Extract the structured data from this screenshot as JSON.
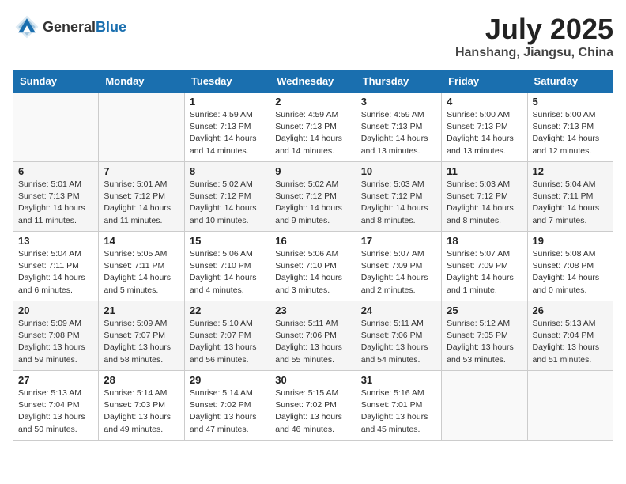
{
  "header": {
    "logo_general": "General",
    "logo_blue": "Blue",
    "title": "July 2025",
    "location": "Hanshang, Jiangsu, China"
  },
  "weekdays": [
    "Sunday",
    "Monday",
    "Tuesday",
    "Wednesday",
    "Thursday",
    "Friday",
    "Saturday"
  ],
  "weeks": [
    [
      {
        "day": "",
        "info": ""
      },
      {
        "day": "",
        "info": ""
      },
      {
        "day": "1",
        "info": "Sunrise: 4:59 AM\nSunset: 7:13 PM\nDaylight: 14 hours and 14 minutes."
      },
      {
        "day": "2",
        "info": "Sunrise: 4:59 AM\nSunset: 7:13 PM\nDaylight: 14 hours and 14 minutes."
      },
      {
        "day": "3",
        "info": "Sunrise: 4:59 AM\nSunset: 7:13 PM\nDaylight: 14 hours and 13 minutes."
      },
      {
        "day": "4",
        "info": "Sunrise: 5:00 AM\nSunset: 7:13 PM\nDaylight: 14 hours and 13 minutes."
      },
      {
        "day": "5",
        "info": "Sunrise: 5:00 AM\nSunset: 7:13 PM\nDaylight: 14 hours and 12 minutes."
      }
    ],
    [
      {
        "day": "6",
        "info": "Sunrise: 5:01 AM\nSunset: 7:13 PM\nDaylight: 14 hours and 11 minutes."
      },
      {
        "day": "7",
        "info": "Sunrise: 5:01 AM\nSunset: 7:12 PM\nDaylight: 14 hours and 11 minutes."
      },
      {
        "day": "8",
        "info": "Sunrise: 5:02 AM\nSunset: 7:12 PM\nDaylight: 14 hours and 10 minutes."
      },
      {
        "day": "9",
        "info": "Sunrise: 5:02 AM\nSunset: 7:12 PM\nDaylight: 14 hours and 9 minutes."
      },
      {
        "day": "10",
        "info": "Sunrise: 5:03 AM\nSunset: 7:12 PM\nDaylight: 14 hours and 8 minutes."
      },
      {
        "day": "11",
        "info": "Sunrise: 5:03 AM\nSunset: 7:12 PM\nDaylight: 14 hours and 8 minutes."
      },
      {
        "day": "12",
        "info": "Sunrise: 5:04 AM\nSunset: 7:11 PM\nDaylight: 14 hours and 7 minutes."
      }
    ],
    [
      {
        "day": "13",
        "info": "Sunrise: 5:04 AM\nSunset: 7:11 PM\nDaylight: 14 hours and 6 minutes."
      },
      {
        "day": "14",
        "info": "Sunrise: 5:05 AM\nSunset: 7:11 PM\nDaylight: 14 hours and 5 minutes."
      },
      {
        "day": "15",
        "info": "Sunrise: 5:06 AM\nSunset: 7:10 PM\nDaylight: 14 hours and 4 minutes."
      },
      {
        "day": "16",
        "info": "Sunrise: 5:06 AM\nSunset: 7:10 PM\nDaylight: 14 hours and 3 minutes."
      },
      {
        "day": "17",
        "info": "Sunrise: 5:07 AM\nSunset: 7:09 PM\nDaylight: 14 hours and 2 minutes."
      },
      {
        "day": "18",
        "info": "Sunrise: 5:07 AM\nSunset: 7:09 PM\nDaylight: 14 hours and 1 minute."
      },
      {
        "day": "19",
        "info": "Sunrise: 5:08 AM\nSunset: 7:08 PM\nDaylight: 14 hours and 0 minutes."
      }
    ],
    [
      {
        "day": "20",
        "info": "Sunrise: 5:09 AM\nSunset: 7:08 PM\nDaylight: 13 hours and 59 minutes."
      },
      {
        "day": "21",
        "info": "Sunrise: 5:09 AM\nSunset: 7:07 PM\nDaylight: 13 hours and 58 minutes."
      },
      {
        "day": "22",
        "info": "Sunrise: 5:10 AM\nSunset: 7:07 PM\nDaylight: 13 hours and 56 minutes."
      },
      {
        "day": "23",
        "info": "Sunrise: 5:11 AM\nSunset: 7:06 PM\nDaylight: 13 hours and 55 minutes."
      },
      {
        "day": "24",
        "info": "Sunrise: 5:11 AM\nSunset: 7:06 PM\nDaylight: 13 hours and 54 minutes."
      },
      {
        "day": "25",
        "info": "Sunrise: 5:12 AM\nSunset: 7:05 PM\nDaylight: 13 hours and 53 minutes."
      },
      {
        "day": "26",
        "info": "Sunrise: 5:13 AM\nSunset: 7:04 PM\nDaylight: 13 hours and 51 minutes."
      }
    ],
    [
      {
        "day": "27",
        "info": "Sunrise: 5:13 AM\nSunset: 7:04 PM\nDaylight: 13 hours and 50 minutes."
      },
      {
        "day": "28",
        "info": "Sunrise: 5:14 AM\nSunset: 7:03 PM\nDaylight: 13 hours and 49 minutes."
      },
      {
        "day": "29",
        "info": "Sunrise: 5:14 AM\nSunset: 7:02 PM\nDaylight: 13 hours and 47 minutes."
      },
      {
        "day": "30",
        "info": "Sunrise: 5:15 AM\nSunset: 7:02 PM\nDaylight: 13 hours and 46 minutes."
      },
      {
        "day": "31",
        "info": "Sunrise: 5:16 AM\nSunset: 7:01 PM\nDaylight: 13 hours and 45 minutes."
      },
      {
        "day": "",
        "info": ""
      },
      {
        "day": "",
        "info": ""
      }
    ]
  ]
}
